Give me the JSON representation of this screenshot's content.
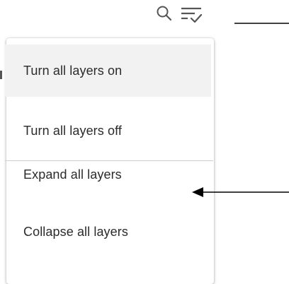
{
  "toolbar": {
    "search_icon": "search-icon",
    "filter_icon": "filter-layers-icon"
  },
  "menu": {
    "items": [
      {
        "label": "Turn all layers on"
      },
      {
        "label": "Turn all layers off"
      },
      {
        "label": "Expand all layers"
      },
      {
        "label": "Collapse all layers"
      }
    ]
  },
  "colors": {
    "menu_text": "#2b2b2b",
    "highlight_bg": "#f2f2f2",
    "divider": "#cfcfcf",
    "annotation": "#000000",
    "icon": "#555555"
  }
}
